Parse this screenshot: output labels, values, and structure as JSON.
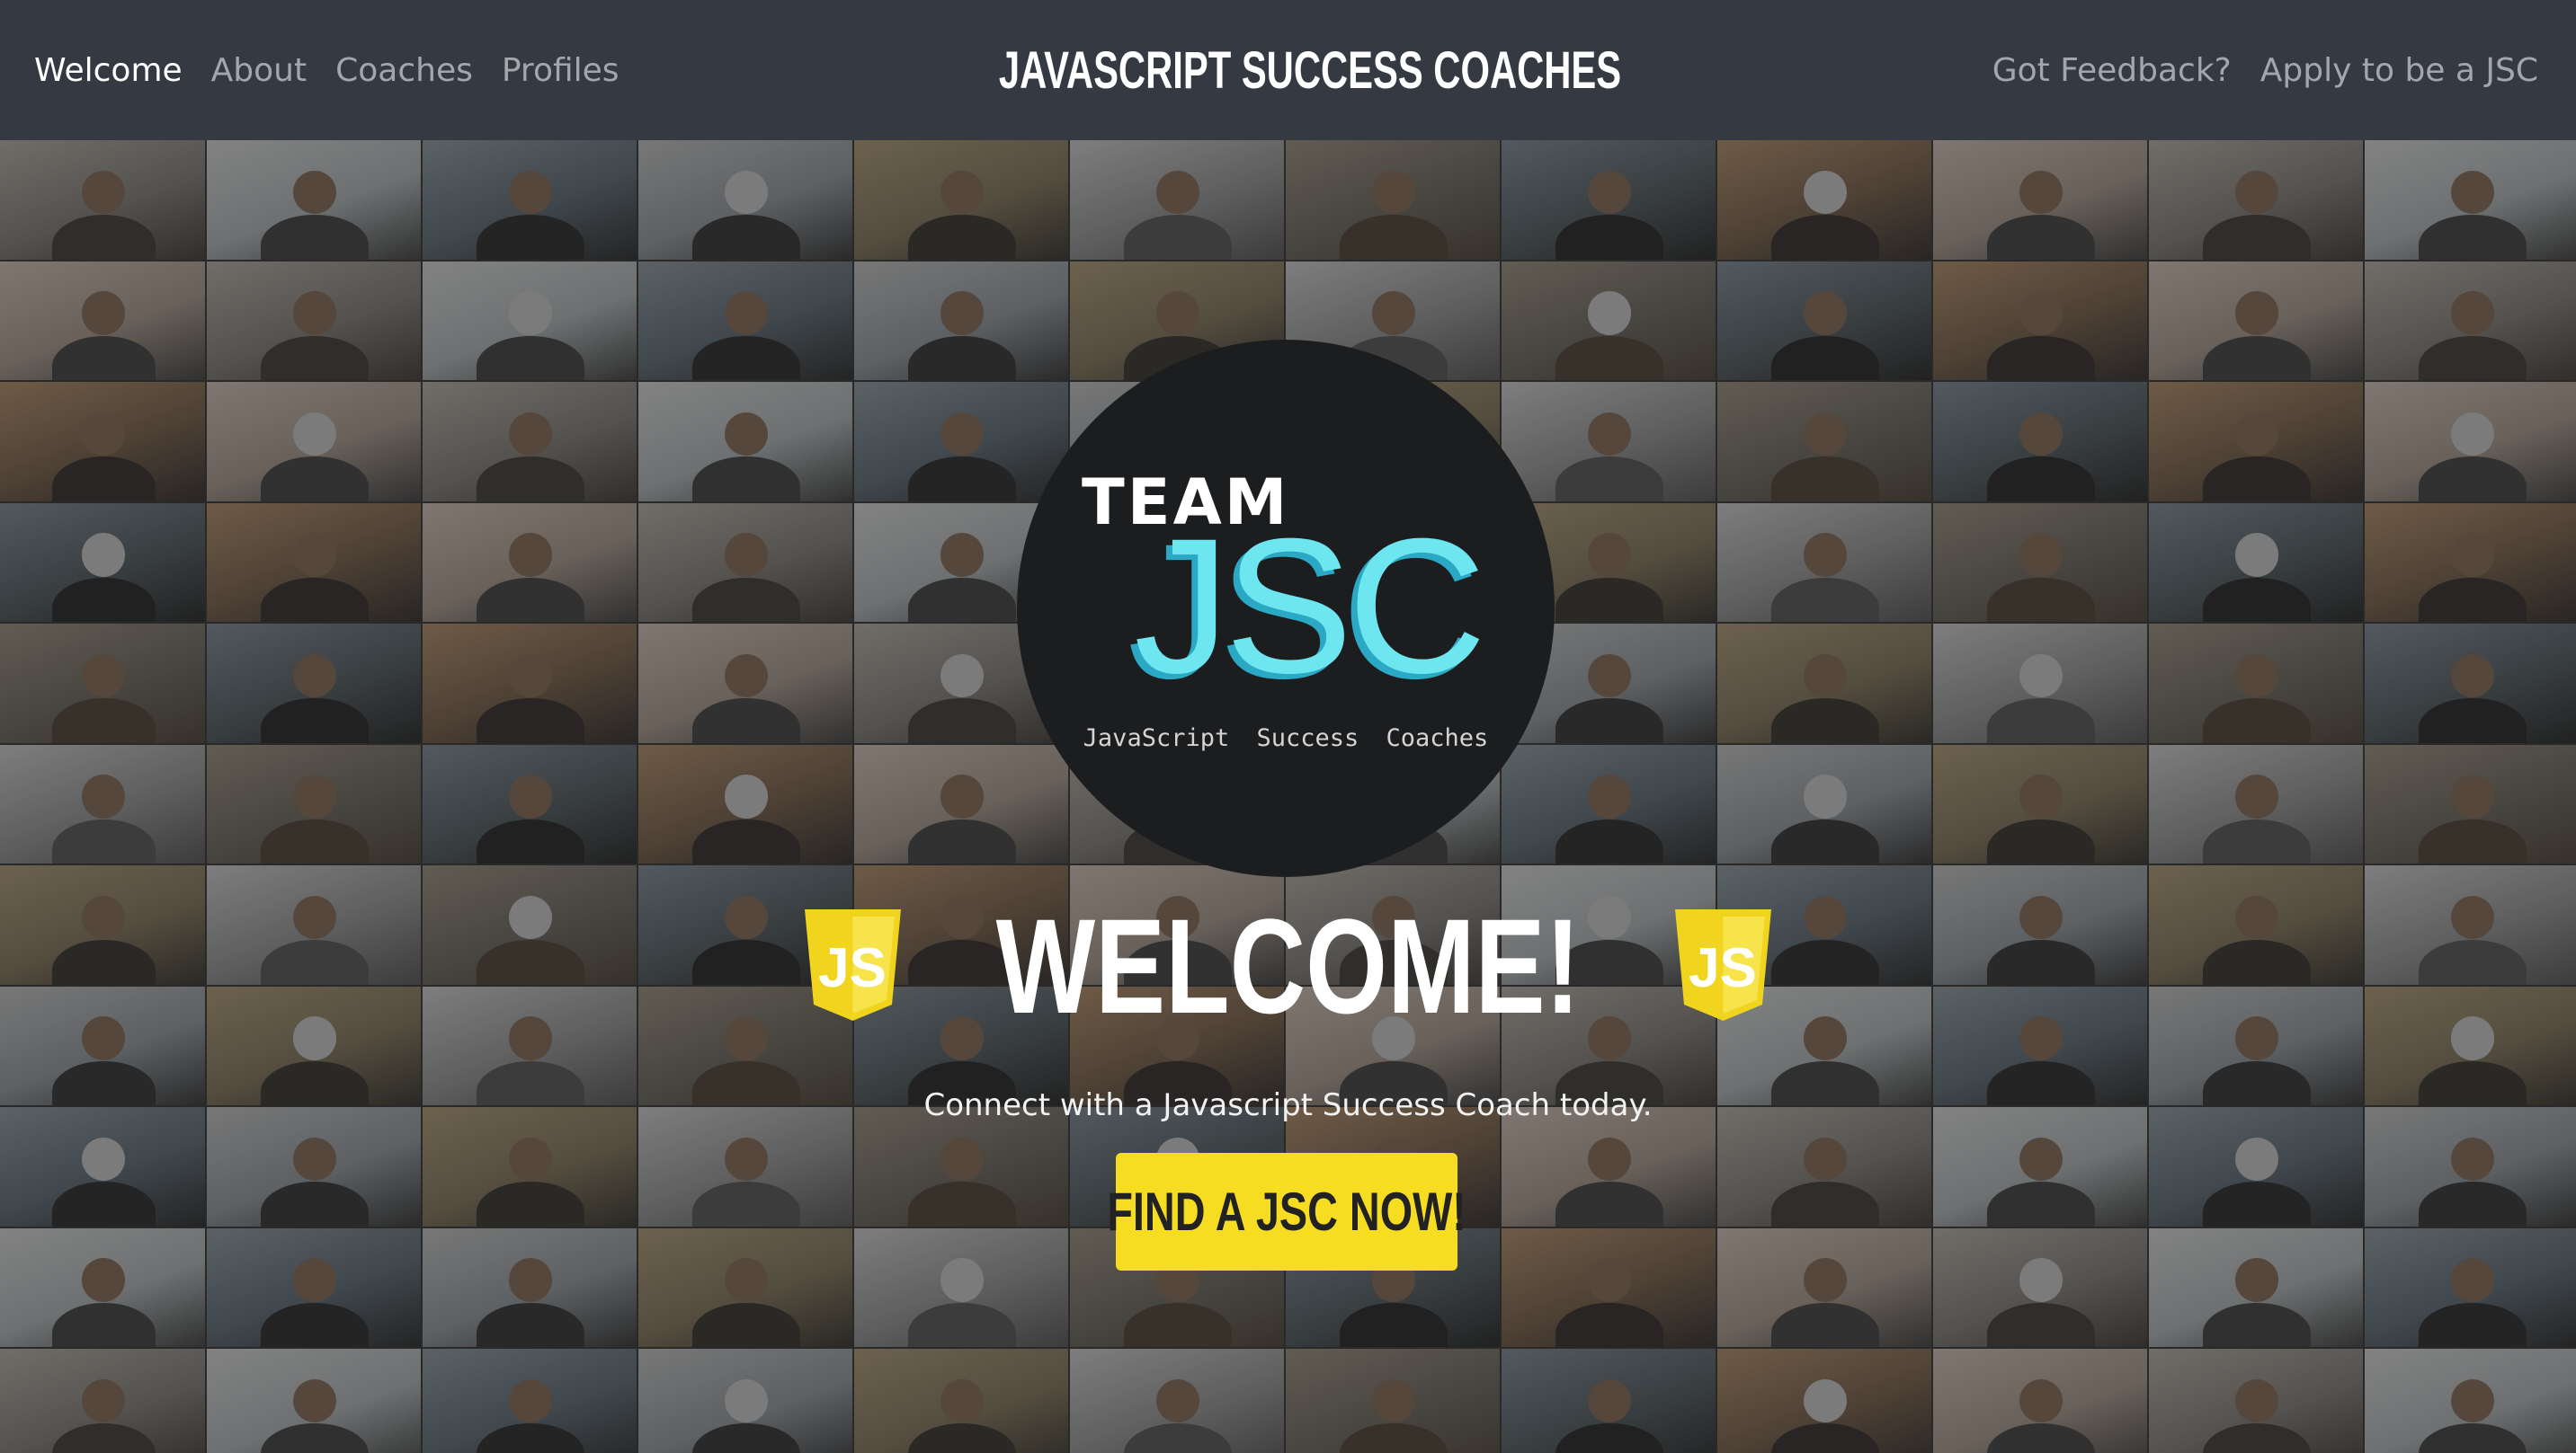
{
  "nav": {
    "left_links": [
      {
        "label": "Welcome",
        "active": true
      },
      {
        "label": "About",
        "active": false
      },
      {
        "label": "Coaches",
        "active": false
      },
      {
        "label": "Profiles",
        "active": false
      }
    ],
    "brand": "JAVASCRIPT SUCCESS COACHES",
    "right_links": [
      {
        "label": "Got Feedback?"
      },
      {
        "label": "Apply to be a JSC"
      }
    ]
  },
  "logo": {
    "team": "TEAM",
    "jsc": "JSC",
    "subtitle": "JavaScript Success Coaches"
  },
  "hero": {
    "welcome": "WELCOME!",
    "shield_text": "JS",
    "tagline": "Connect with a Javascript Success Coach today.",
    "cta_label": "FIND A JSC NOW!"
  },
  "colors": {
    "navbar": "#353a42",
    "cta": "#f7dd22",
    "js_shield": "#f0d41e",
    "logo_accent": "#6ee6ef",
    "logo_circle": "#1c1d1f"
  },
  "icons": {
    "js_shield": "javascript-logo-icon"
  }
}
